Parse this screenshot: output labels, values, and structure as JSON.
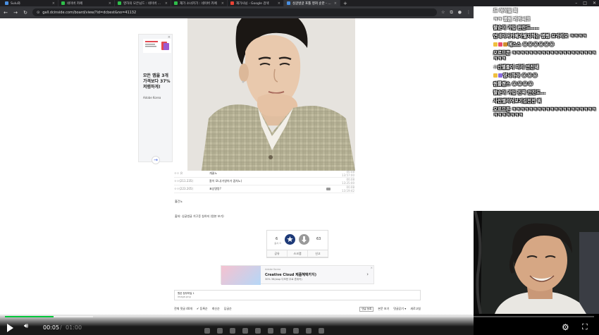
{
  "browser": {
    "tabs": [
      {
        "label": "Sulu와",
        "active": false,
        "fav": "b"
      },
      {
        "label": "네이버 카페",
        "active": false,
        "fav": "g"
      },
      {
        "label": "영하의 모은님드 : 네이버 카페",
        "active": false,
        "fav": "g"
      },
      {
        "label": "재가 소녀카가 : 네이버 카페",
        "active": false,
        "fav": "g"
      },
      {
        "label": "재가사님 - Google 검색",
        "active": false,
        "fav": "gg"
      },
      {
        "label": "싱글벙글 포톨 영혀 순한 - 실시...",
        "active": true,
        "fav": "b"
      }
    ],
    "new_tab": "+",
    "url": "gall.dcinside.com/board/view/?id=dcbest&no=41132"
  },
  "ad_left": {
    "close": "×",
    "text": "모든 앱을 3개\n가격보다 37%\n저렴하게!",
    "brand": "Adobe Korea",
    "arrow": "→"
  },
  "comments": [
    {
      "name": "ㅇㅇ 유",
      "text": "개꿀노",
      "time": "00.08 13:57:00"
    },
    {
      "name": "ㅇㅇ(211.235)",
      "text": "잘이 모니(가영어가 겸차노)",
      "time": "00.08 13:25:00"
    },
    {
      "name": "ㅇㅇ(223.205)",
      "text": "표상명랑?",
      "time": "00.08 13:19:42"
    }
  ],
  "body": {
    "line1": "흘건노",
    "line2": "출처: 싱글벙글 치구준 칭하지 (원본 보기)"
  },
  "vote": {
    "up_count": "6",
    "up_sub": "실시 0",
    "down_count": "63",
    "actions": [
      "공유",
      "스크랩",
      "신고"
    ]
  },
  "ad_banner": {
    "top": "Adobe Korea",
    "title": "Creative Cloud 제품혜택카지)",
    "sub": "30% 36(stop 다모한 무료 혼위카)",
    "arrow": "›",
    "close": "×"
  },
  "source": {
    "title": "원본 첨부파일 1",
    "file": "image.png"
  },
  "comment_bar": {
    "total": "전체 댓글 40개",
    "sort1": "✔ 등록순",
    "sort2": "최신순",
    "sort3": "답글순",
    "btn1": "댓글 등록",
    "btn2": "본문 보기",
    "btn3": "댓글닫기 ▾",
    "btn4": "새로고침"
  },
  "video": {
    "current": "00:05",
    "sep": "/",
    "duration": "01:00",
    "progress": 0.083,
    "loaded": 0.15
  },
  "chat": {
    "messages": [
      {
        "text": "드 아이일 회",
        "faded": true
      },
      {
        "text": "ㅋㅋ 명원 가카씨크",
        "faded": true
      },
      {
        "text": "팔순이 가입 완란드.....",
        "faded": false
      },
      {
        "text": "연네이버카페가벌지하는 명령 요가리오 ㅋㅋㅋㅋ",
        "faded": false
      },
      {
        "text": "예스스 😭😭😭😭😭😭",
        "faded": false,
        "badges": [
          "#f0c040",
          "#e84c6c",
          "#d09030"
        ]
      },
      {
        "text": "오르므믄 ㅋㅋㅋㅋㅋㅋㅋㅋㅋㅋㅋㅋㅋㅋㅋㅋㅋㅋㅋㅋㅋㅋㅋ",
        "faded": false
      },
      {
        "text": "☆신델들이 미리 안진돼",
        "faded": false
      },
      {
        "text": "양시하라 😭😭😭",
        "faded": false,
        "badges": [
          "#f0c040",
          "#8a6be0"
        ]
      },
      {
        "text": "원틀랜스 😭😭😭😭",
        "faded": false
      },
      {
        "text": "팔순이 가입 진짜 안진도...",
        "faded": false
      },
      {
        "text": "사진앨리어보기김전전 뭐",
        "faded": false
      },
      {
        "text": "오르므믄 ㅋㅋㅋㅋㅋㅋㅋㅋㅋㅋㅋㅋㅋㅋㅋㅋㅋㅋㅋㅋㅋㅋㅋㅋㅋㅋㅋ",
        "faded": false
      }
    ]
  }
}
